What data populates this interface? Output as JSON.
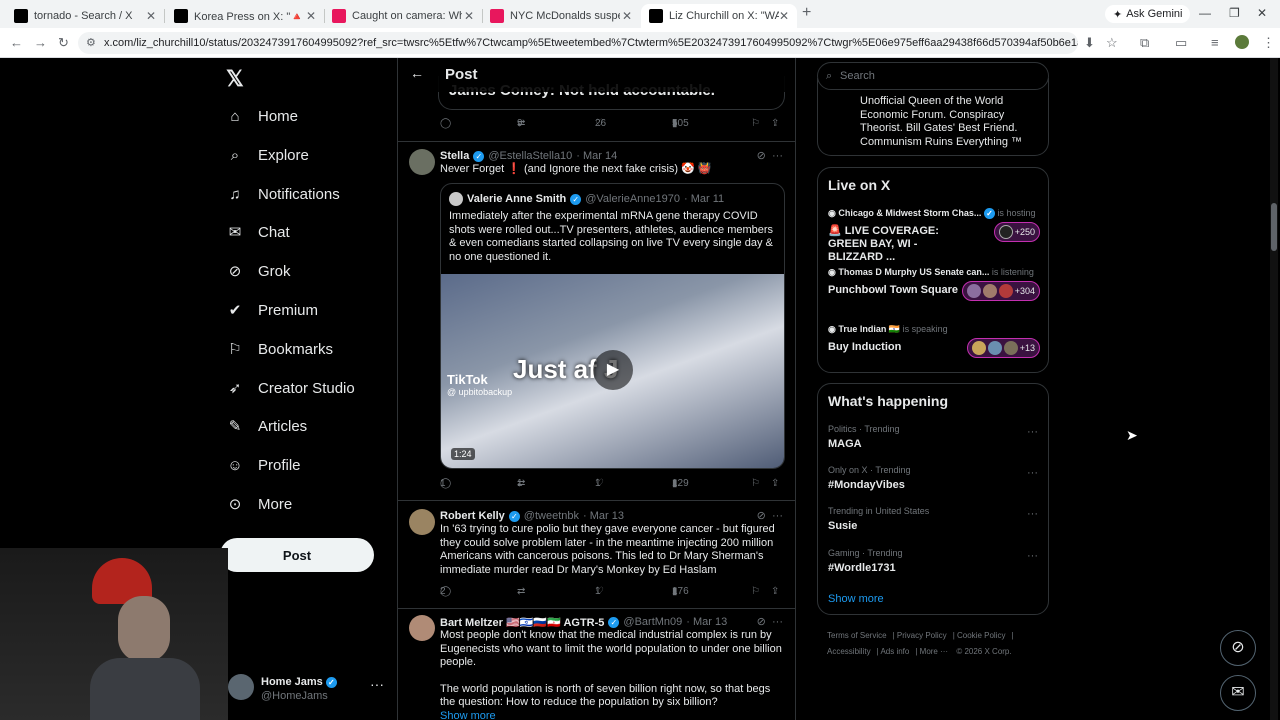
{
  "browser": {
    "tabs": [
      {
        "title": "tornado - Search / X",
        "color": "#000000"
      },
      {
        "title": "Korea Press on X: \"🔺🔺🔺 Tru",
        "color": "#000000"
      },
      {
        "title": "Caught on camera: Whataburg",
        "color": "#e8175d"
      },
      {
        "title": "NYC McDonalds suspects indic",
        "color": "#e8175d"
      },
      {
        "title": "Liz Churchill on X: \"WAR CRIM",
        "color": "#000000"
      }
    ],
    "gemini_label": "Ask Gemini",
    "url": "x.com/liz_churchill10/status/2032473917604995092?ref_src=twsrc%5Etfw%7Ctwcamp%5Etweetembed%7Ctwterm%5E2032473917604995092%7Ctwgr%5E06e975eff6aa29438f66d570394af50b6e1a6d11d%7Ctwcon%5Es1_&ref_url=http..."
  },
  "sidebar": {
    "items": [
      {
        "label": "Home",
        "icon": "⌂"
      },
      {
        "label": "Explore",
        "icon": "⌕"
      },
      {
        "label": "Notifications",
        "icon": "🔔"
      },
      {
        "label": "Chat",
        "icon": "✉"
      },
      {
        "label": "Grok",
        "icon": "⊘"
      },
      {
        "label": "Premium",
        "icon": "✔"
      },
      {
        "label": "Bookmarks",
        "icon": "🔖"
      },
      {
        "label": "Creator Studio",
        "icon": "🚀"
      },
      {
        "label": "Articles",
        "icon": "✎"
      },
      {
        "label": "Profile",
        "icon": "👤"
      },
      {
        "label": "More",
        "icon": "⋯"
      }
    ],
    "post_label": "Post",
    "account": {
      "name": "Home Jams",
      "handle": "@HomeJams"
    }
  },
  "header": {
    "title": "Post"
  },
  "top_quote_text": "James Comey: Not held accountable.",
  "top_actions": {
    "replies": "",
    "reposts": "9",
    "likes": "26",
    "views": "505"
  },
  "tweets": [
    {
      "name": "Stella",
      "handle": "@EstellaStella10",
      "date": "· Mar 14",
      "text": "Never Forget ❗ (and Ignore the next fake crisis) 🤡 👹",
      "quote": {
        "name": "Valerie Anne Smith",
        "handle": "@ValerieAnne1970",
        "date": "· Mar 11",
        "text": "Immediately after the experimental mRNA gene therapy COVID shots were rolled out...TV presenters, athletes, audience members & even comedians started collapsing on live TV every single day & no one questioned it.",
        "video": {
          "caption": "Just af      J",
          "brand": "TikTok",
          "brand_handle": "@ upbitobackup",
          "duration": "1:24"
        }
      },
      "actions": {
        "replies": "1",
        "reposts": "1",
        "likes": "1",
        "views": "129"
      }
    },
    {
      "name": "Robert Kelly",
      "handle": "@tweetnbk",
      "date": "· Mar 13",
      "text": "In '63 trying to cure polio but they gave everyone cancer  - but figured they could solve problem later - in the meantime injecting 200 million Americans with cancerous poisons. This led to Dr Mary Sherman's immediate murder read Dr Mary's Monkey by Ed Haslam",
      "actions": {
        "replies": "2",
        "reposts": "",
        "likes": "1",
        "views": "176"
      }
    },
    {
      "name": "Bart Meltzer 🇺🇸🇮🇱🇷🇺🇮🇷 AGTR-5",
      "handle": "@BartMn09",
      "date": "· Mar 13",
      "text": "Most people don't know that the medical industrial complex is run by Eugenecists who want to limit the world population to under one billion people.",
      "text2": "The world population is north of seven billion right now, so that begs the question: How to reduce the population by six billion?",
      "show_more": "Show more"
    }
  ],
  "right": {
    "search_placeholder": "Search",
    "bio": "Unofficial Queen of the World Economic Forum. Conspiracy Theorist. Bill Gates' Best Friend. Communism Ruins Everything ™",
    "live_title": "Live on X",
    "live": [
      {
        "host": "Chicago & Midwest Storm Chas...",
        "status": "is hosting",
        "title": "🚨 LIVE COVERAGE: GREEN BAY, WI - BLIZZARD ...",
        "count": "+250"
      },
      {
        "host": "Thomas D Murphy US Senate can...",
        "status": "is listening",
        "title": "Punchbowl Town Square",
        "count": "+304"
      },
      {
        "host": "True Indian 🇮🇳",
        "status": "is speaking",
        "title": "Buy Induction",
        "count": "+13"
      }
    ],
    "happening_title": "What's happening",
    "trends": [
      {
        "context": "Politics · Trending",
        "name": "MAGA"
      },
      {
        "context": "Only on X · Trending",
        "name": "#MondayVibes"
      },
      {
        "context": "Trending in United States",
        "name": "Susie"
      },
      {
        "context": "Gaming · Trending",
        "name": "#Wordle1731"
      }
    ],
    "show_more": "Show more",
    "footer": [
      "Terms of Service",
      "Privacy Policy",
      "Cookie Policy",
      "Accessibility",
      "Ads info",
      "More ···",
      "© 2026 X Corp."
    ]
  }
}
